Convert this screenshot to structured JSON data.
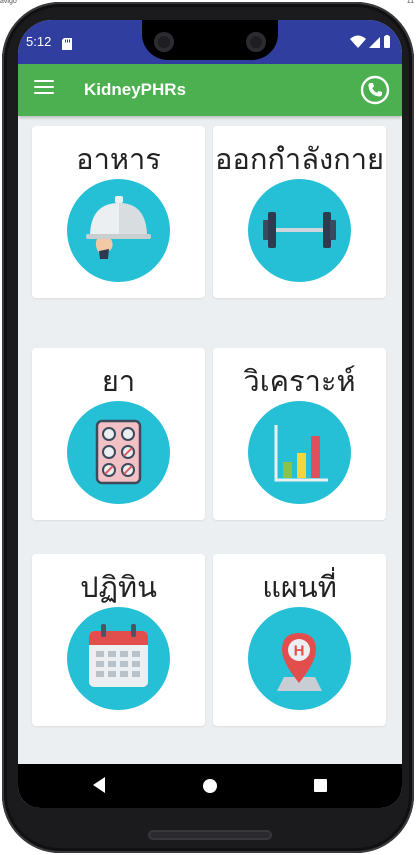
{
  "browser_strip": {
    "left": "avigo",
    "right": "11"
  },
  "status_bar": {
    "time": "5:12"
  },
  "app_bar": {
    "title": "KidneyPHRs"
  },
  "menu": [
    {
      "label": "อาหาร",
      "icon": "food-tray-icon"
    },
    {
      "label": "ออกกำลังกาย",
      "icon": "dumbbell-icon"
    },
    {
      "label": "ยา",
      "icon": "pill-pack-icon"
    },
    {
      "label": "วิเคราะห์",
      "icon": "bar-chart-icon"
    },
    {
      "label": "ปฏิทิน",
      "icon": "calendar-icon"
    },
    {
      "label": "แผนที่",
      "icon": "hospital-map-pin-icon"
    }
  ],
  "colors": {
    "status_bar": "#303f9f",
    "app_bar": "#4caf50",
    "icon_circle": "#26c0d6",
    "background": "#eceff1"
  }
}
